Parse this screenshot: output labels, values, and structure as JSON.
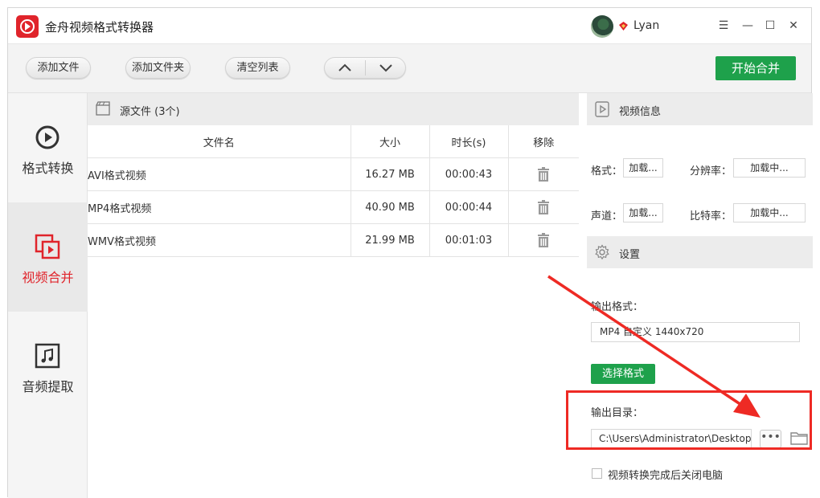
{
  "app": {
    "title": "金舟视频格式转换器",
    "user_name": "Lyan"
  },
  "window_controls": {
    "menu": "☰",
    "minimize": "—",
    "maximize": "☐",
    "close": "✕"
  },
  "toolbar": {
    "add_file": "添加文件",
    "add_folder": "添加文件夹",
    "clear_list": "清空列表",
    "start_merge": "开始合并"
  },
  "sidebar": {
    "items": [
      {
        "label": "格式转换",
        "icon": "play-circle-icon",
        "active": false
      },
      {
        "label": "视频合并",
        "icon": "video-merge-icon",
        "active": true
      },
      {
        "label": "音频提取",
        "icon": "music-note-icon",
        "active": false
      }
    ]
  },
  "source": {
    "title": "源文件 (3个)",
    "columns": [
      "文件名",
      "大小",
      "时长(s)",
      "移除"
    ],
    "rows": [
      {
        "name": "AVI格式视频",
        "size": "16.27 MB",
        "duration": "00:00:43"
      },
      {
        "name": "MP4格式视频",
        "size": "40.90 MB",
        "duration": "00:00:44"
      },
      {
        "name": "WMV格式视频",
        "size": "21.99 MB",
        "duration": "00:01:03"
      }
    ]
  },
  "video_info": {
    "title": "视频信息",
    "format_label": "格式：",
    "format_value": "加载...",
    "resolution_label": "分辨率：",
    "resolution_value": "加载中...",
    "channel_label": "声道：",
    "channel_value": "加载...",
    "bitrate_label": "比特率：",
    "bitrate_value": "加载中..."
  },
  "settings": {
    "title": "设置",
    "output_format_label": "输出格式：",
    "output_format_value": "MP4 自定义 1440x720",
    "select_format": "选择格式",
    "output_dir_label": "输出目录：",
    "output_dir_value": "C:\\Users\\Administrator\\Desktop",
    "more_button": "•••",
    "shutdown_label": "视频转换完成后关闭电脑"
  },
  "colors": {
    "accent_green": "#1ea14b",
    "brand_red": "#e0242b",
    "annotation_red": "#ee2a24"
  }
}
